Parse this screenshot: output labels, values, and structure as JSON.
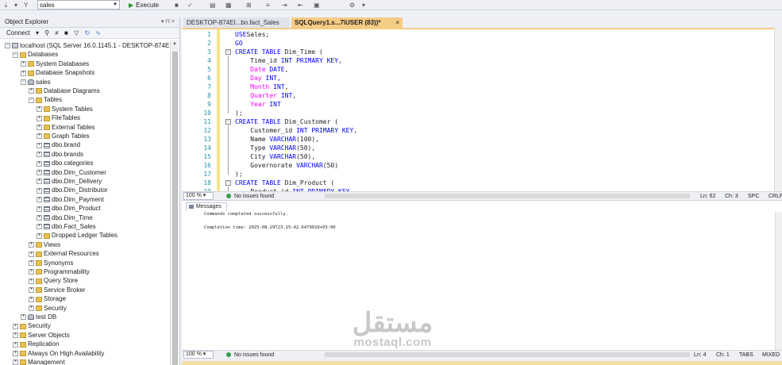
{
  "toolbar": {
    "database": "sales",
    "execute_label": "Execute"
  },
  "object_explorer": {
    "title": "Object Explorer",
    "pin_glyphs": "▾ ⊓ ×",
    "connect_label": "Connect",
    "tree": [
      {
        "label": "localhost (SQL Server 16.0.1145.1 - DESKTOP-874EIE7\\",
        "indent": 0,
        "exp": "−",
        "icon": "server"
      },
      {
        "label": "Databases",
        "indent": 1,
        "exp": "−",
        "icon": "folder"
      },
      {
        "label": "System Databases",
        "indent": 2,
        "exp": "+",
        "icon": "folder"
      },
      {
        "label": "Database Snapshots",
        "indent": 2,
        "exp": "+",
        "icon": "folder"
      },
      {
        "label": "sales",
        "indent": 2,
        "exp": "−",
        "icon": "db"
      },
      {
        "label": "Database Diagrams",
        "indent": 3,
        "exp": "+",
        "icon": "folder"
      },
      {
        "label": "Tables",
        "indent": 3,
        "exp": "−",
        "icon": "folder"
      },
      {
        "label": "System Tables",
        "indent": 4,
        "exp": "+",
        "icon": "folder"
      },
      {
        "label": "FileTables",
        "indent": 4,
        "exp": "+",
        "icon": "folder"
      },
      {
        "label": "External Tables",
        "indent": 4,
        "exp": "+",
        "icon": "folder"
      },
      {
        "label": "Graph Tables",
        "indent": 4,
        "exp": "+",
        "icon": "folder"
      },
      {
        "label": "dbo.brand",
        "indent": 4,
        "exp": "+",
        "icon": "table"
      },
      {
        "label": "dbo.brands",
        "indent": 4,
        "exp": "+",
        "icon": "table"
      },
      {
        "label": "dbo.categories",
        "indent": 4,
        "exp": "+",
        "icon": "table"
      },
      {
        "label": "dbo.Dim_Customer",
        "indent": 4,
        "exp": "+",
        "icon": "table"
      },
      {
        "label": "dbo.Dim_Delivery",
        "indent": 4,
        "exp": "+",
        "icon": "table"
      },
      {
        "label": "dbo.Dim_Distributor",
        "indent": 4,
        "exp": "+",
        "icon": "table"
      },
      {
        "label": "dbo.Dim_Payment",
        "indent": 4,
        "exp": "+",
        "icon": "table"
      },
      {
        "label": "dbo.Dim_Product",
        "indent": 4,
        "exp": "+",
        "icon": "table"
      },
      {
        "label": "dbo.Dim_Time",
        "indent": 4,
        "exp": "+",
        "icon": "table"
      },
      {
        "label": "dbo.Fact_Sales",
        "indent": 4,
        "exp": "+",
        "icon": "table"
      },
      {
        "label": "Dropped Ledger Tables",
        "indent": 4,
        "exp": "+",
        "icon": "folder"
      },
      {
        "label": "Views",
        "indent": 3,
        "exp": "+",
        "icon": "folder"
      },
      {
        "label": "External Resources",
        "indent": 3,
        "exp": "+",
        "icon": "folder"
      },
      {
        "label": "Synonyms",
        "indent": 3,
        "exp": "+",
        "icon": "folder"
      },
      {
        "label": "Programmability",
        "indent": 3,
        "exp": "+",
        "icon": "folder"
      },
      {
        "label": "Query Store",
        "indent": 3,
        "exp": "+",
        "icon": "folder"
      },
      {
        "label": "Service Broker",
        "indent": 3,
        "exp": "+",
        "icon": "folder"
      },
      {
        "label": "Storage",
        "indent": 3,
        "exp": "+",
        "icon": "folder"
      },
      {
        "label": "Security",
        "indent": 3,
        "exp": "+",
        "icon": "folder"
      },
      {
        "label": "test DB",
        "indent": 2,
        "exp": "+",
        "icon": "db"
      },
      {
        "label": "Security",
        "indent": 1,
        "exp": "+",
        "icon": "folder"
      },
      {
        "label": "Server Objects",
        "indent": 1,
        "exp": "+",
        "icon": "folder"
      },
      {
        "label": "Replication",
        "indent": 1,
        "exp": "+",
        "icon": "folder"
      },
      {
        "label": "Always On High Availability",
        "indent": 1,
        "exp": "+",
        "icon": "folder"
      },
      {
        "label": "Management",
        "indent": 1,
        "exp": "+",
        "icon": "folder"
      }
    ]
  },
  "tabs": {
    "inactive": "DESKTOP-874EI...bo.fact_Sales",
    "active": "SQLQuery1.s...7\\USER (83))*",
    "close_glyph": "×"
  },
  "editor": {
    "lines": [
      {
        "n": "1",
        "code": [
          [
            "kw",
            "USE"
          ],
          [
            "",
            "Sales;"
          ]
        ]
      },
      {
        "n": "2",
        "code": [
          [
            "kw",
            "GO"
          ]
        ]
      },
      {
        "n": "3",
        "code": [
          [
            "kw",
            "CREATE TABLE"
          ],
          [
            "",
            " Dim_Time ("
          ]
        ]
      },
      {
        "n": "4",
        "code": [
          [
            "",
            "    Time_id "
          ],
          [
            "kw",
            "INT PRIMARY KEY"
          ],
          [
            "",
            ","
          ]
        ]
      },
      {
        "n": "5",
        "code": [
          [
            "col",
            "    Date"
          ],
          [
            "",
            " "
          ],
          [
            "kw",
            "DATE"
          ],
          [
            "",
            ","
          ]
        ]
      },
      {
        "n": "6",
        "code": [
          [
            "col",
            "    Day"
          ],
          [
            "",
            " "
          ],
          [
            "kw",
            "INT"
          ],
          [
            "",
            ","
          ]
        ]
      },
      {
        "n": "7",
        "code": [
          [
            "col",
            "    Month"
          ],
          [
            "",
            " "
          ],
          [
            "kw",
            "INT"
          ],
          [
            "",
            ","
          ]
        ]
      },
      {
        "n": "8",
        "code": [
          [
            "col",
            "    Quarter"
          ],
          [
            "",
            " "
          ],
          [
            "kw",
            "INT"
          ],
          [
            "",
            ","
          ]
        ]
      },
      {
        "n": "9",
        "code": [
          [
            "col",
            "    Year"
          ],
          [
            "",
            " "
          ],
          [
            "kw",
            "INT"
          ]
        ]
      },
      {
        "n": "10",
        "code": [
          [
            "",
            ");"
          ]
        ]
      },
      {
        "n": "11",
        "code": [
          [
            "kw",
            "CREATE TABLE"
          ],
          [
            "",
            " Dim_Customer ("
          ]
        ]
      },
      {
        "n": "12",
        "code": [
          [
            "",
            "    Customer_id "
          ],
          [
            "kw",
            "INT PRIMARY KEY"
          ],
          [
            "",
            ","
          ]
        ]
      },
      {
        "n": "13",
        "code": [
          [
            "",
            "    Name "
          ],
          [
            "kw",
            "VARCHAR"
          ],
          [
            "",
            "(100),"
          ]
        ]
      },
      {
        "n": "14",
        "code": [
          [
            "",
            "    Type "
          ],
          [
            "kw",
            "VARCHAR"
          ],
          [
            "",
            "(50),"
          ]
        ]
      },
      {
        "n": "15",
        "code": [
          [
            "",
            "    City "
          ],
          [
            "kw",
            "VARCHAR"
          ],
          [
            "",
            "(50),"
          ]
        ]
      },
      {
        "n": "16",
        "code": [
          [
            "",
            "    Governorate "
          ],
          [
            "kw",
            "VARCHAR"
          ],
          [
            "",
            "(50)"
          ]
        ]
      },
      {
        "n": "17",
        "code": [
          [
            "",
            ");"
          ]
        ]
      },
      {
        "n": "18",
        "code": [
          [
            "kw",
            "CREATE TABLE"
          ],
          [
            "",
            " Dim_Product ("
          ]
        ]
      },
      {
        "n": "19",
        "code": [
          [
            "",
            "    Product_id "
          ],
          [
            "kw",
            "INT PRIMARY KEY"
          ]
        ]
      }
    ]
  },
  "editor_status": {
    "zoom": "100 %",
    "issues": "No issues found",
    "ln": "Ln: 62",
    "ch": "Ch: 3",
    "mode": "SPC",
    "eol": "CRLF"
  },
  "messages": {
    "tab_label": "Messages",
    "line1": "Commands completed successfully.",
    "line2": "Completion time: 2025-08-29T23:15:42.6479910+03:00"
  },
  "bottom_status": {
    "zoom": "100 %",
    "issues": "No issues found",
    "ln": "Ln: 4",
    "ch": "Ch: 1",
    "mode": "TABS",
    "eol": "MIXED"
  },
  "watermark": {
    "arabic": "مستقل",
    "latin": "mostaql.com"
  },
  "colors": {
    "keyword": "#0000ff",
    "column": "#ff00ff",
    "line_number": "#2b91af",
    "active_tab": "#f5cc84"
  }
}
